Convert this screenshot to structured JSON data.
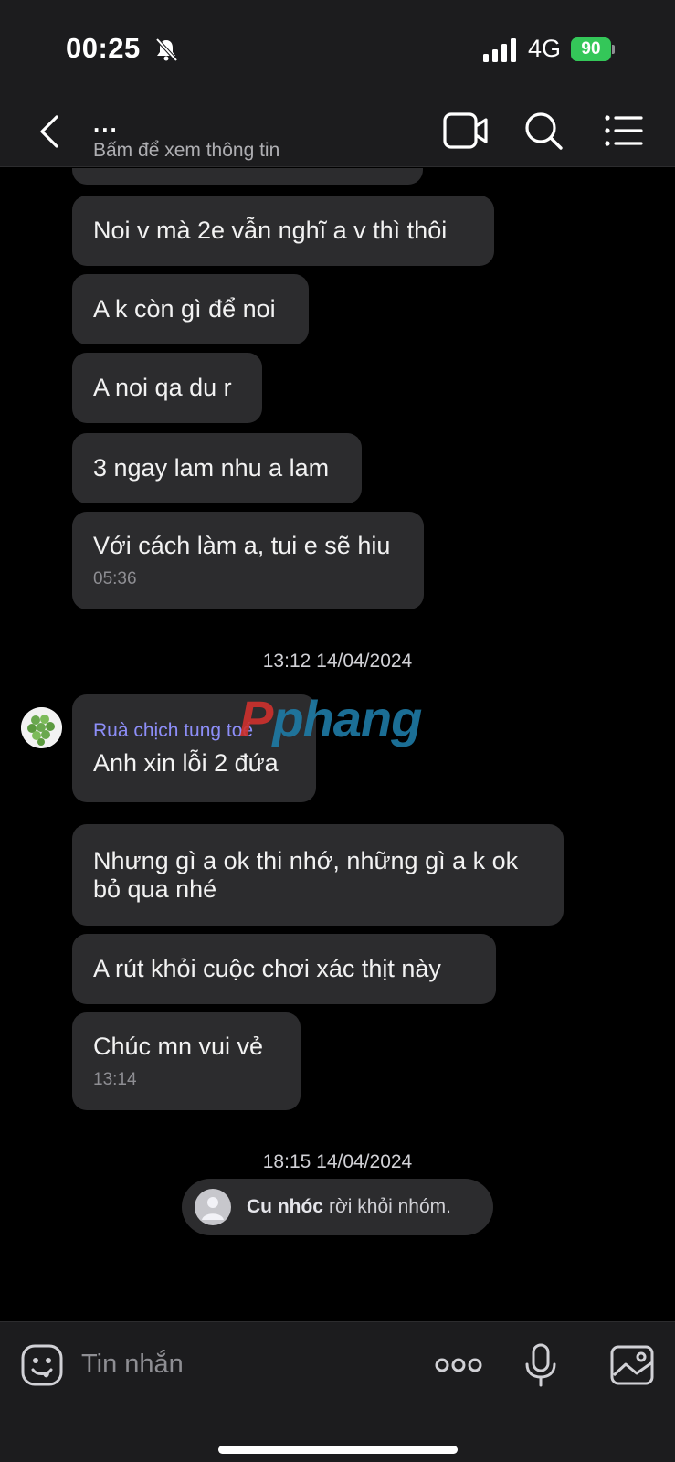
{
  "status_bar": {
    "time": "00:25",
    "network": "4G",
    "battery": "90",
    "battery_color": "#34c759"
  },
  "header": {
    "group_name": "...",
    "subtitle": "Bấm để xem thông tin",
    "icons": [
      "back-icon",
      "video-call-icon",
      "search-icon",
      "list-menu-icon"
    ]
  },
  "messages": [
    {
      "text": "Noi v mà 2e vẫn nghĩ a v thì thôi"
    },
    {
      "text": "A k còn gì để noi"
    },
    {
      "text": "A noi qa du r"
    },
    {
      "text": "3 ngay lam nhu a lam"
    },
    {
      "text": "Với cách làm a, tui e sẽ hiu",
      "time": "05:36"
    },
    {
      "date": "13:12 14/04/2024"
    },
    {
      "sender": "Ruà chịch tung toé",
      "text": "Anh xin lỗi 2 đứa"
    },
    {
      "text_line1": "Nhưng gì a ok thi nhớ, những gì a k ok",
      "text_line2": "bỏ qua nhé"
    },
    {
      "text": "A rút khỏi cuộc chơi xác thịt này"
    },
    {
      "text": "Chúc mn vui vẻ",
      "time": "13:14"
    },
    {
      "date": "18:15 14/04/2024"
    }
  ],
  "system_message": {
    "name": "Cu nhóc",
    "text": "rời khỏi nhóm."
  },
  "watermark": {
    "letter": "P",
    "rest": "phang"
  },
  "input": {
    "placeholder": "Tin nhắn",
    "icons": [
      "emoji-icon",
      "more-options-icon",
      "microphone-icon",
      "image-icon"
    ]
  },
  "colors": {
    "bubble": "#2c2c2e",
    "sender_name": "#8d8ef8",
    "background": "#000000",
    "header": "#1c1c1e"
  }
}
